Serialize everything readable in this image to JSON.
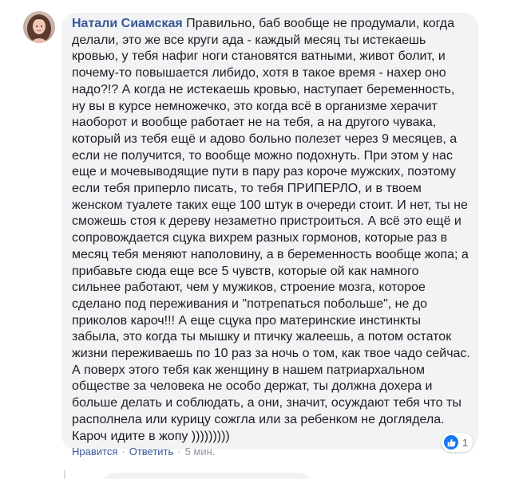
{
  "comment": {
    "author": "Натали Сиамская",
    "text": "Правильно, баб вообще не продумали, когда делали, это же все круги ада - каждый месяц ты истекаешь кровью, у тебя нафиг ноги становятся ватными, живот болит, и почему-то повышается либидо, хотя в такое время - нахер оно надо?!? А когда не истекаешь кровью, наступает беременность, ну вы в курсе немножечко, это когда всё в организме херачит наоборот и вообще работает не на тебя, а на другого чувака, который из тебя ещё и адово больно полезет через 9 месяцев, а если не получится, то вообще можно подохнуть. При этом у нас еще и мочевыводящие пути в пару раз короче мужских, поэтому если тебя приперло писать, то тебя ПРИПЕРЛО, и в твоем женском туалете таких еще 100 штук в очереди стоит. И нет, ты не сможешь стоя к дереву незаметно пристроиться. А всё это ещё и сопровождается сцука вихрем разных гормонов, которые раз в месяц тебя меняют наполовину, а в беременность вообще жопа; а прибавьте сюда еще все 5 чувств, которые ой как намного сильнее работают, чем у мужиков, строение мозга, которое сделано под переживания и \"потрепаться побольше\", не до приколов кароч!!! А еще сцука про материнские инстинкты забыла, это когда ты мышку и птичку жалеешь, а потом остаток жизни переживаешь по 10 раз за ночь о том, как твое чадо сейчас. А поверх этого тебя как женщину в нашем патриархальном обществе за человека не особо держат, ты должна дохера и больше делать и соблюдать, а они, значит, осуждают тебя что ты располнела или курицу сожгла или за ребенком не доглядела. Кароч идите в жопу )))))))))"
  },
  "reactions": {
    "icon": "like-icon",
    "count": "1",
    "color": "#1877f2"
  },
  "actions": {
    "like": "Нравится",
    "reply": "Ответить",
    "separator": "·",
    "timestamp": "5 мин."
  },
  "colors": {
    "author_link": "#385898",
    "bubble_bg": "#f2f3f5",
    "meta_text": "#90949c"
  }
}
